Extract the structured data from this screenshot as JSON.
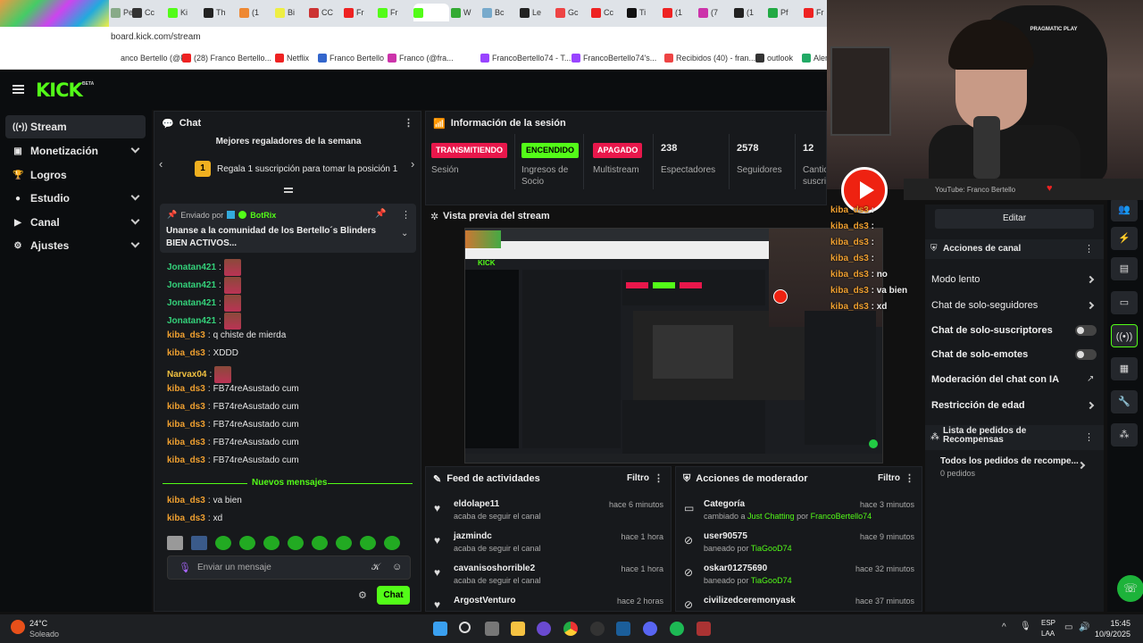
{
  "browser": {
    "url": "board.kick.com/stream",
    "tabs": [
      {
        "label": "Pe",
        "color": "#8a8"
      },
      {
        "label": "Cc",
        "color": "#333"
      },
      {
        "label": "Ki",
        "color": "#53fc18"
      },
      {
        "label": "Th",
        "color": "#222"
      },
      {
        "label": "(1",
        "color": "#e83"
      },
      {
        "label": "Bi",
        "color": "#ee4"
      },
      {
        "label": "CC",
        "color": "#c33"
      },
      {
        "label": "Fr",
        "color": "#e22"
      },
      {
        "label": "Fr",
        "color": "#53fc18"
      },
      {
        "label": "",
        "color": "#53fc18"
      },
      {
        "label": "W",
        "color": "#3a3"
      },
      {
        "label": "Bc",
        "color": "#7ac"
      },
      {
        "label": "Le",
        "color": "#222"
      },
      {
        "label": "Gc",
        "color": "#e44"
      },
      {
        "label": "Cc",
        "color": "#e22"
      },
      {
        "label": "Ti",
        "color": "#111"
      },
      {
        "label": "(1",
        "color": "#e22"
      },
      {
        "label": "(7",
        "color": "#c3a"
      },
      {
        "label": "(1",
        "color": "#222"
      },
      {
        "label": "Pf",
        "color": "#2a4"
      },
      {
        "label": "Fr",
        "color": "#e22"
      }
    ],
    "bookmarks": [
      {
        "label": "anco Bertello (@F...",
        "color": "#fff"
      },
      {
        "label": "(28) Franco Bertello...",
        "color": "#e22"
      },
      {
        "label": "Netflix",
        "color": "#e22"
      },
      {
        "label": "Franco Bertello",
        "color": "#36c"
      },
      {
        "label": "Franco (@fra...",
        "color": "#c3a"
      },
      {
        "label": "FrancoBertello74 - T...",
        "color": "#94f"
      },
      {
        "label": "FrancoBertello74's...",
        "color": "#94f"
      },
      {
        "label": "Recibidos (40) - fran...",
        "color": "#e44"
      },
      {
        "label": "outlook",
        "color": "#333"
      },
      {
        "label": "Aler",
        "color": "#2a6"
      }
    ]
  },
  "app": {
    "logo": "KICK",
    "beta": "BETA"
  },
  "sidebar": {
    "items": [
      {
        "label": "Stream",
        "icon": "((•))",
        "chevron": false
      },
      {
        "label": "Monetización",
        "icon": "▣",
        "chevron": true
      },
      {
        "label": "Logros",
        "icon": "🏆",
        "chevron": false
      },
      {
        "label": "Estudio",
        "icon": "●",
        "chevron": true
      },
      {
        "label": "Canal",
        "icon": "▶",
        "chevron": true
      },
      {
        "label": "Ajustes",
        "icon": "⚙",
        "chevron": true
      }
    ]
  },
  "chat": {
    "title": "Chat",
    "top_gifters_title": "Mejores regaladores de la semana",
    "top_gifters_rank": "1",
    "top_gifters_cta": "Regala 1 suscripción para tomar la posición 1",
    "pinned_sent_by": "Enviado por",
    "pinned_user": "BotRix",
    "pinned_text": "Unanse a la comunidad de los Bertello´s Blinders BIEN ACTIVOS...",
    "new_messages": "Nuevos mensajes",
    "input_placeholder": "Enviar un mensaje",
    "send_label": "Chat",
    "messages": [
      {
        "user": "Jonatan421",
        "text": "",
        "emote": true,
        "color": "#34d17a"
      },
      {
        "user": "Jonatan421",
        "text": "",
        "emote": true,
        "color": "#34d17a"
      },
      {
        "user": "Jonatan421",
        "text": "",
        "emote": true,
        "color": "#34d17a"
      },
      {
        "user": "Jonatan421",
        "text": "",
        "emote": true,
        "color": "#34d17a"
      },
      {
        "user": "kiba_ds3",
        "text": "q chiste de mierda",
        "emote": false,
        "color": "#f0a030"
      },
      {
        "user": "kiba_ds3",
        "text": "XDDD",
        "emote": false,
        "color": "#f0a030"
      },
      {
        "user": "Narvax04",
        "text": "",
        "emote": true,
        "color": "#f0c040"
      },
      {
        "user": "kiba_ds3",
        "text": "FB74reAsustado cum",
        "emote": false,
        "color": "#f0a030"
      },
      {
        "user": "kiba_ds3",
        "text": "FB74reAsustado cum",
        "emote": false,
        "color": "#f0a030"
      },
      {
        "user": "kiba_ds3",
        "text": "FB74reAsustado cum",
        "emote": false,
        "color": "#f0a030"
      },
      {
        "user": "kiba_ds3",
        "text": "FB74reAsustado cum",
        "emote": false,
        "color": "#f0a030"
      },
      {
        "user": "kiba_ds3",
        "text": "FB74reAsustado cum",
        "emote": false,
        "color": "#f0a030"
      }
    ],
    "new_msgs": [
      {
        "user": "kiba_ds3",
        "text": "va bien",
        "color": "#f0a030"
      },
      {
        "user": "kiba_ds3",
        "text": "xd",
        "color": "#f0a030"
      }
    ]
  },
  "session": {
    "title": "Información de la sesión",
    "stats": [
      {
        "badge": "TRANSMITIENDO",
        "badge_bg": "#e8174b",
        "badge_fg": "#ffffff",
        "label": "Sesión"
      },
      {
        "badge": "ENCENDIDO",
        "badge_bg": "#53fc18",
        "badge_fg": "#000000",
        "label": "Ingresos de Socio"
      },
      {
        "badge": "APAGADO",
        "badge_bg": "#e8174b",
        "badge_fg": "#ffffff",
        "label": "Multistream"
      },
      {
        "value": "238",
        "label": "Espectadores"
      },
      {
        "value": "2578",
        "label": "Seguidores"
      },
      {
        "value": "12",
        "label": "Cantic suscri"
      }
    ]
  },
  "preview": {
    "title": "Vista previa del stream"
  },
  "feed": {
    "title": "Feed de actividades",
    "filter": "Filtro",
    "items": [
      {
        "name": "eldolape11",
        "sub": "acaba de seguir el canal",
        "time": "hace 6 minutos"
      },
      {
        "name": "jazmindc",
        "sub": "acaba de seguir el canal",
        "time": "hace 1 hora"
      },
      {
        "name": "cavanisoshorrible2",
        "sub": "acaba de seguir el canal",
        "time": "hace 1 hora"
      },
      {
        "name": "ArgostVenturo",
        "sub": "",
        "time": "hace 2 horas"
      }
    ]
  },
  "modactions": {
    "title": "Acciones de moderador",
    "filter": "Filtro",
    "items": [
      {
        "name": "Categoría",
        "sub_a": "cambiado a ",
        "sub_b": "Just Chatting",
        "sub_c": " por ",
        "sub_d": "FrancoBertello74",
        "time": "hace 3 minutos",
        "icon": "▭"
      },
      {
        "name": "user90575",
        "sub_a": "baneado por ",
        "sub_b": "TiaGooD74",
        "sub_c": "",
        "sub_d": "",
        "time": "hace 9 minutos",
        "icon": "⊘"
      },
      {
        "name": "oskar01275690",
        "sub_a": "baneado por ",
        "sub_b": "TiaGooD74",
        "sub_c": "",
        "sub_d": "",
        "time": "hace 32 minutos",
        "icon": "⊘"
      },
      {
        "name": "civilizedceremonyask",
        "sub_a": "",
        "sub_b": "",
        "sub_c": "",
        "sub_d": "",
        "time": "hace 37 minutos",
        "icon": "⊘"
      }
    ]
  },
  "modpanel": {
    "edit": "Editar",
    "channel_actions": "Acciones de canal",
    "slow_mode": "Modo lento",
    "followers_only": "Chat de solo-seguidores",
    "subs_only": "Chat de solo-suscriptores",
    "emotes_only": "Chat de solo-emotes",
    "ai_mod": "Moderación del chat con IA",
    "age_restriction": "Restricción de edad",
    "rewards_title": "Lista de pedidos de Recompensas",
    "rewards_all": "Todos los pedidos de recompe...",
    "rewards_count": "0 pedidos"
  },
  "webcam": {
    "yt_label": "YouTube: Franco Bertello",
    "chair_brand": "PRAGMATIC PLAY",
    "overlay_chat": [
      {
        "user": "kiba_ds3",
        "text": ":"
      },
      {
        "user": "kiba_ds3",
        "text": ":"
      },
      {
        "user": "kiba_ds3",
        "text": ":"
      },
      {
        "user": "kiba_ds3",
        "text": ":"
      },
      {
        "user": "kiba_ds3",
        "text": ": no"
      },
      {
        "user": "kiba_ds3",
        "text": ": va bien"
      },
      {
        "user": "kiba_ds3",
        "text": ": xd"
      }
    ]
  },
  "taskbar": {
    "temp": "24°C",
    "weather": "Soleado",
    "lang1": "ESP",
    "lang2": "LAA",
    "time": "15:45",
    "date": "10/9/2025"
  }
}
